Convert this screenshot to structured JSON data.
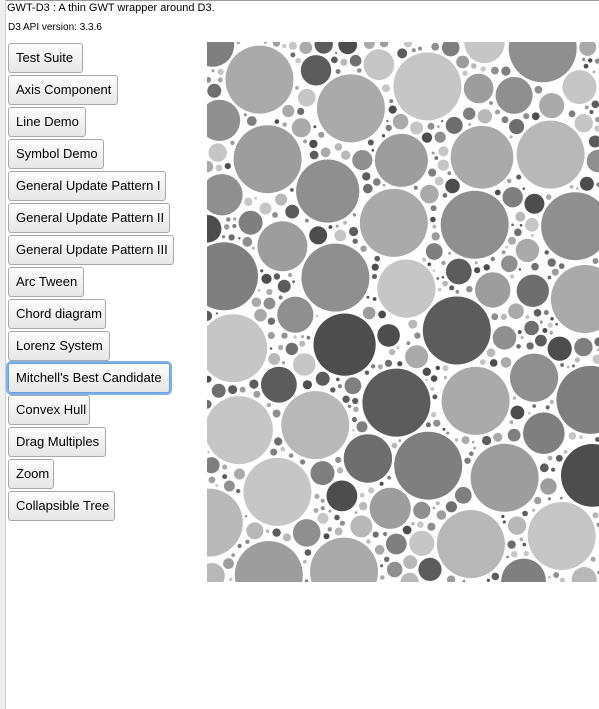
{
  "header": {
    "title": "GWT-D3 : A thin GWT wrapper around D3.",
    "api_version": "D3 API version: 3.3.6"
  },
  "demo_buttons": [
    {
      "label": "Test Suite"
    },
    {
      "label": "Axis Component"
    },
    {
      "label": "Line Demo"
    },
    {
      "label": "Symbol Demo"
    },
    {
      "label": "General Update Pattern I"
    },
    {
      "label": "General Update Pattern II"
    },
    {
      "label": "General Update Pattern III"
    },
    {
      "label": "Arc Tween"
    },
    {
      "label": "Chord diagram"
    },
    {
      "label": "Lorenz System"
    },
    {
      "label": "Mitchell's Best Candidate",
      "focused": true
    },
    {
      "label": "Convex Hull"
    },
    {
      "label": "Drag Multiples"
    },
    {
      "label": "Zoom"
    },
    {
      "label": "Collapsible Tree"
    }
  ],
  "demo_view": {
    "name": "Mitchell's Best Candidate circle packing",
    "colors": [
      "#4d4d4d",
      "#5c5c5c",
      "#6e6e6e",
      "#7f7f7f",
      "#8f8f8f",
      "#9d9d9d",
      "#aaaaaa",
      "#b8b8b8",
      "#c6c6c6"
    ]
  }
}
